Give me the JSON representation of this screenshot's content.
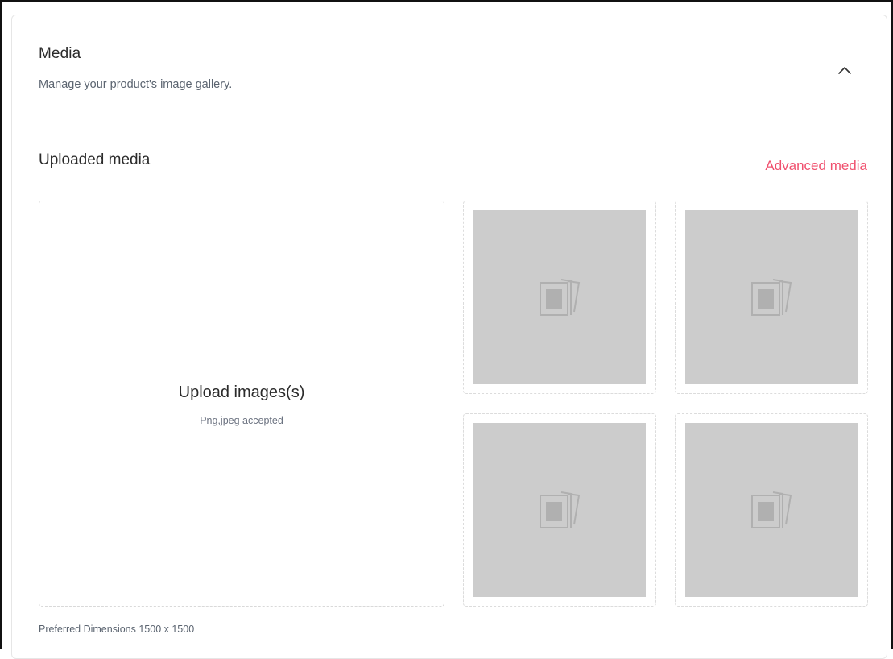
{
  "header": {
    "title": "Media",
    "subtitle": "Manage your product's image gallery."
  },
  "uploaded_media": {
    "title": "Uploaded media",
    "advanced_link": "Advanced media"
  },
  "upload_zone": {
    "title": "Upload images(s)",
    "hint": "Png,jpeg accepted"
  },
  "thumbnails": [
    {
      "icon": "image-placeholder-icon"
    },
    {
      "icon": "image-placeholder-icon"
    },
    {
      "icon": "image-placeholder-icon"
    },
    {
      "icon": "image-placeholder-icon"
    }
  ],
  "footer": {
    "dimensions_note": "Preferred Dimensions 1500 x 1500"
  },
  "colors": {
    "accent": "#f0506e",
    "placeholder_fill": "#cccccc",
    "muted_text": "#5b6470"
  }
}
